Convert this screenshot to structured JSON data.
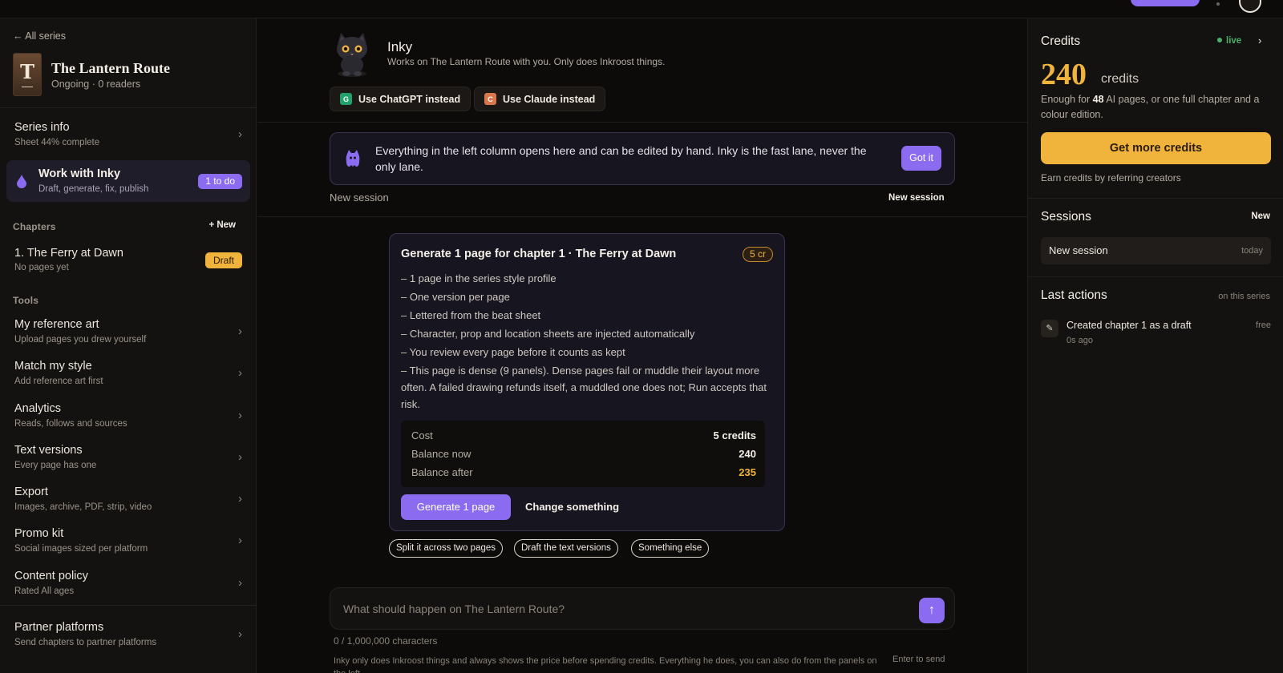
{
  "sidebar": {
    "back_label": "← All series",
    "series": {
      "cover_letter": "T",
      "title": "The Lantern Route",
      "subtitle": "Ongoing · 0 readers"
    },
    "series_info": {
      "title": "Series info",
      "subtitle": "Sheet 44% complete"
    },
    "inky": {
      "title": "Work with Inky",
      "subtitle": "Draft, generate, fix, publish",
      "badge": "1 to do"
    },
    "chapters_label": "Chapters",
    "new_chapter_label": "+ New",
    "chapters": [
      {
        "title": "1. The Ferry at Dawn",
        "subtitle": "No pages yet",
        "status": "Draft"
      }
    ],
    "tools_label": "Tools",
    "tools": [
      {
        "title": "My reference art",
        "subtitle": "Upload pages you drew yourself"
      },
      {
        "title": "Match my style",
        "subtitle": "Add reference art first"
      },
      {
        "title": "Analytics",
        "subtitle": "Reads, follows and sources"
      },
      {
        "title": "Text versions",
        "subtitle": "Every page has one"
      },
      {
        "title": "Export",
        "subtitle": "Images, archive, PDF, strip, video"
      },
      {
        "title": "Promo kit",
        "subtitle": "Social images sized per platform"
      },
      {
        "title": "Content policy",
        "subtitle": "Rated All ages"
      }
    ],
    "partner": {
      "title": "Partner platforms",
      "subtitle": "Send chapters to partner platforms"
    }
  },
  "main": {
    "assistant_name": "Inky",
    "assistant_desc": "Works on The Lantern Route with you. Only does Inkroost things.",
    "alt_chatgpt": {
      "badge": "G",
      "label": "Use ChatGPT instead",
      "color": "#22a06b"
    },
    "alt_claude": {
      "badge": "C",
      "label": "Use Claude instead",
      "color": "#d9774b"
    },
    "notice_text": "Everything in the left column opens here and can be edited by hand. Inky is the fast lane, never the only lane.",
    "notice_button": "Got it",
    "session_label": "New session",
    "session_button": "New session",
    "card": {
      "title": "Generate 1 page for chapter 1 · The Ferry at Dawn",
      "cost_badge": "5 cr",
      "bullets": [
        "– 1 page in the series style profile",
        "– One version per page",
        "– Lettered from the beat sheet",
        "– Character, prop and location sheets are injected automatically",
        "– You review every page before it counts as kept",
        "– This page is dense (9 panels). Dense pages fail or muddle their layout more often. A failed drawing refunds itself, a muddled one does not; Run accepts that risk."
      ],
      "cost_label": "Cost",
      "cost_value": "5 credits",
      "balance_now_label": "Balance now",
      "balance_now_value": "240",
      "balance_after_label": "Balance after",
      "balance_after_value": "235",
      "primary_button": "Generate 1 page",
      "secondary_button": "Change something"
    },
    "chips": [
      "Split it across two pages",
      "Draft the text versions",
      "Something else"
    ],
    "composer_placeholder": "What should happen on The Lantern Route?",
    "send_icon": "↑",
    "char_count": "0 / 1,000,000 characters",
    "footnote": "Inky only does Inkroost things and always shows the price before spending credits. Everything he does, you can also do from the panels on the left.",
    "enter_hint": "Enter to send"
  },
  "right": {
    "credits_title": "Credits",
    "live_label": "live",
    "credits_value": "240",
    "credits_unit": "credits",
    "credits_note_pre": "Enough for ",
    "credits_note_num": "48",
    "credits_note_post": " AI pages, or one full chapter and a colour edition.",
    "buy_button": "Get more credits",
    "refer_text": "Earn credits by referring creators",
    "sessions_title": "Sessions",
    "sessions_new": "New",
    "sessions": [
      {
        "name": "New session",
        "date": "today"
      }
    ],
    "last_actions_title": "Last actions",
    "last_actions_scope": "on this series",
    "actions": [
      {
        "icon": "✎",
        "text": "Created chapter 1 as a draft",
        "age": "0s ago",
        "cost": "free"
      }
    ]
  },
  "colors": {
    "accent": "#8b6cf0",
    "amber": "#f0b43c",
    "live": "#4caf6a"
  }
}
